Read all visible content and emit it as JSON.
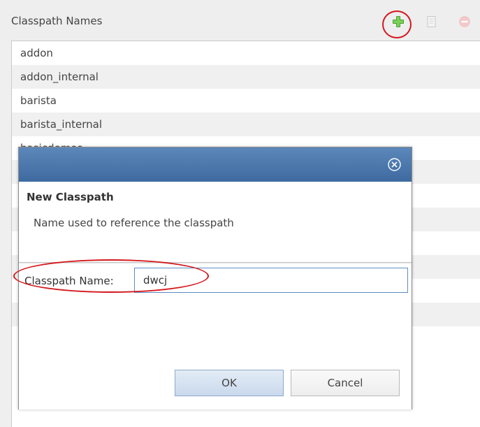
{
  "panel": {
    "title": "Classpath Names",
    "toolbar": {
      "add_icon": "plus-icon",
      "copy_icon": "copy-document-icon",
      "remove_icon": "minus-circle-icon"
    }
  },
  "list": {
    "items": [
      "addon",
      "addon_internal",
      "barista",
      "barista_internal",
      "basicdemos",
      "",
      "",
      "",
      "",
      "",
      "",
      ""
    ]
  },
  "dialog": {
    "close_icon": "close-circle-icon",
    "heading": "New Classpath",
    "description": "Name used to reference the classpath",
    "field_label": "Classpath Name:",
    "field_value": "dwcj",
    "ok_label": "OK",
    "cancel_label": "Cancel"
  },
  "colors": {
    "title_bar": "#4b77ab",
    "annotation": "#d4171b",
    "add_green": "#4aa02c"
  }
}
